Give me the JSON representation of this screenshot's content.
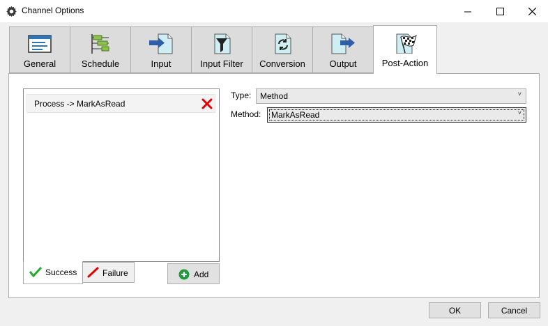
{
  "window": {
    "title": "Channel Options",
    "icon": "gear-icon",
    "controls": [
      "minimize-icon",
      "maximize-icon",
      "close-icon"
    ]
  },
  "tabs": [
    {
      "label": "General",
      "icon": "window-icon",
      "active": false
    },
    {
      "label": "Schedule",
      "icon": "schedule-icon",
      "active": false
    },
    {
      "label": "Input",
      "icon": "input-arrow-icon",
      "active": false
    },
    {
      "label": "Input Filter",
      "icon": "filter-icon",
      "active": false
    },
    {
      "label": "Conversion",
      "icon": "conversion-icon",
      "active": false
    },
    {
      "label": "Output",
      "icon": "output-arrow-icon",
      "active": false
    },
    {
      "label": "Post-Action",
      "icon": "checkered-flag-icon",
      "active": true
    }
  ],
  "post_action": {
    "list_items": [
      {
        "label": "Process -> MarkAsRead"
      }
    ],
    "subtabs": [
      {
        "label": "Success",
        "icon": "checkmark-icon",
        "active": true
      },
      {
        "label": "Failure",
        "icon": "red-slash-icon",
        "active": false
      }
    ],
    "add_label": "Add",
    "type_label": "Type:",
    "type_value": "Method",
    "method_label": "Method:",
    "method_value": "MarkAsRead"
  },
  "dialog": {
    "ok_label": "OK",
    "cancel_label": "Cancel"
  },
  "colors": {
    "accent_blue": "#2e75b6",
    "success_green": "#1fae2b",
    "remove_red": "#e00000"
  }
}
